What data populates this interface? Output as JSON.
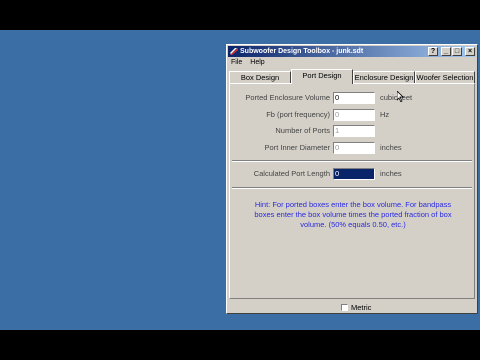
{
  "window": {
    "title": "Subwoofer Design Toolbox - junk.sdt",
    "controls": [
      "?",
      "_",
      "□",
      "×"
    ]
  },
  "menu": {
    "items": [
      "File",
      "Help"
    ]
  },
  "tabs": [
    {
      "label": "Box Design",
      "active": false
    },
    {
      "label": "Port Design",
      "active": true
    },
    {
      "label": "Enclosure Design",
      "active": false
    },
    {
      "label": "Woofer Selection",
      "active": false
    }
  ],
  "form": {
    "ported_volume": {
      "label": "Ported Enclosure Volume",
      "value": "0",
      "unit": "cubic feet"
    },
    "fb": {
      "label": "Fb (port frequency)",
      "value": "0",
      "unit": "Hz"
    },
    "num_ports": {
      "label": "Number of Ports",
      "value": "1",
      "unit": ""
    },
    "port_diameter": {
      "label": "Port Inner Diameter",
      "value": "0",
      "unit": "inches"
    },
    "port_length": {
      "label": "Calculated Port Length",
      "value": "0",
      "unit": "inches"
    }
  },
  "hint": "Hint: For ported boxes enter the box volume.  For bandpass boxes enter the box volume times the ported fraction of box volume.  (50% equals 0.50, etc.)",
  "status": {
    "metric_label": "Metric",
    "metric_checked": false
  }
}
